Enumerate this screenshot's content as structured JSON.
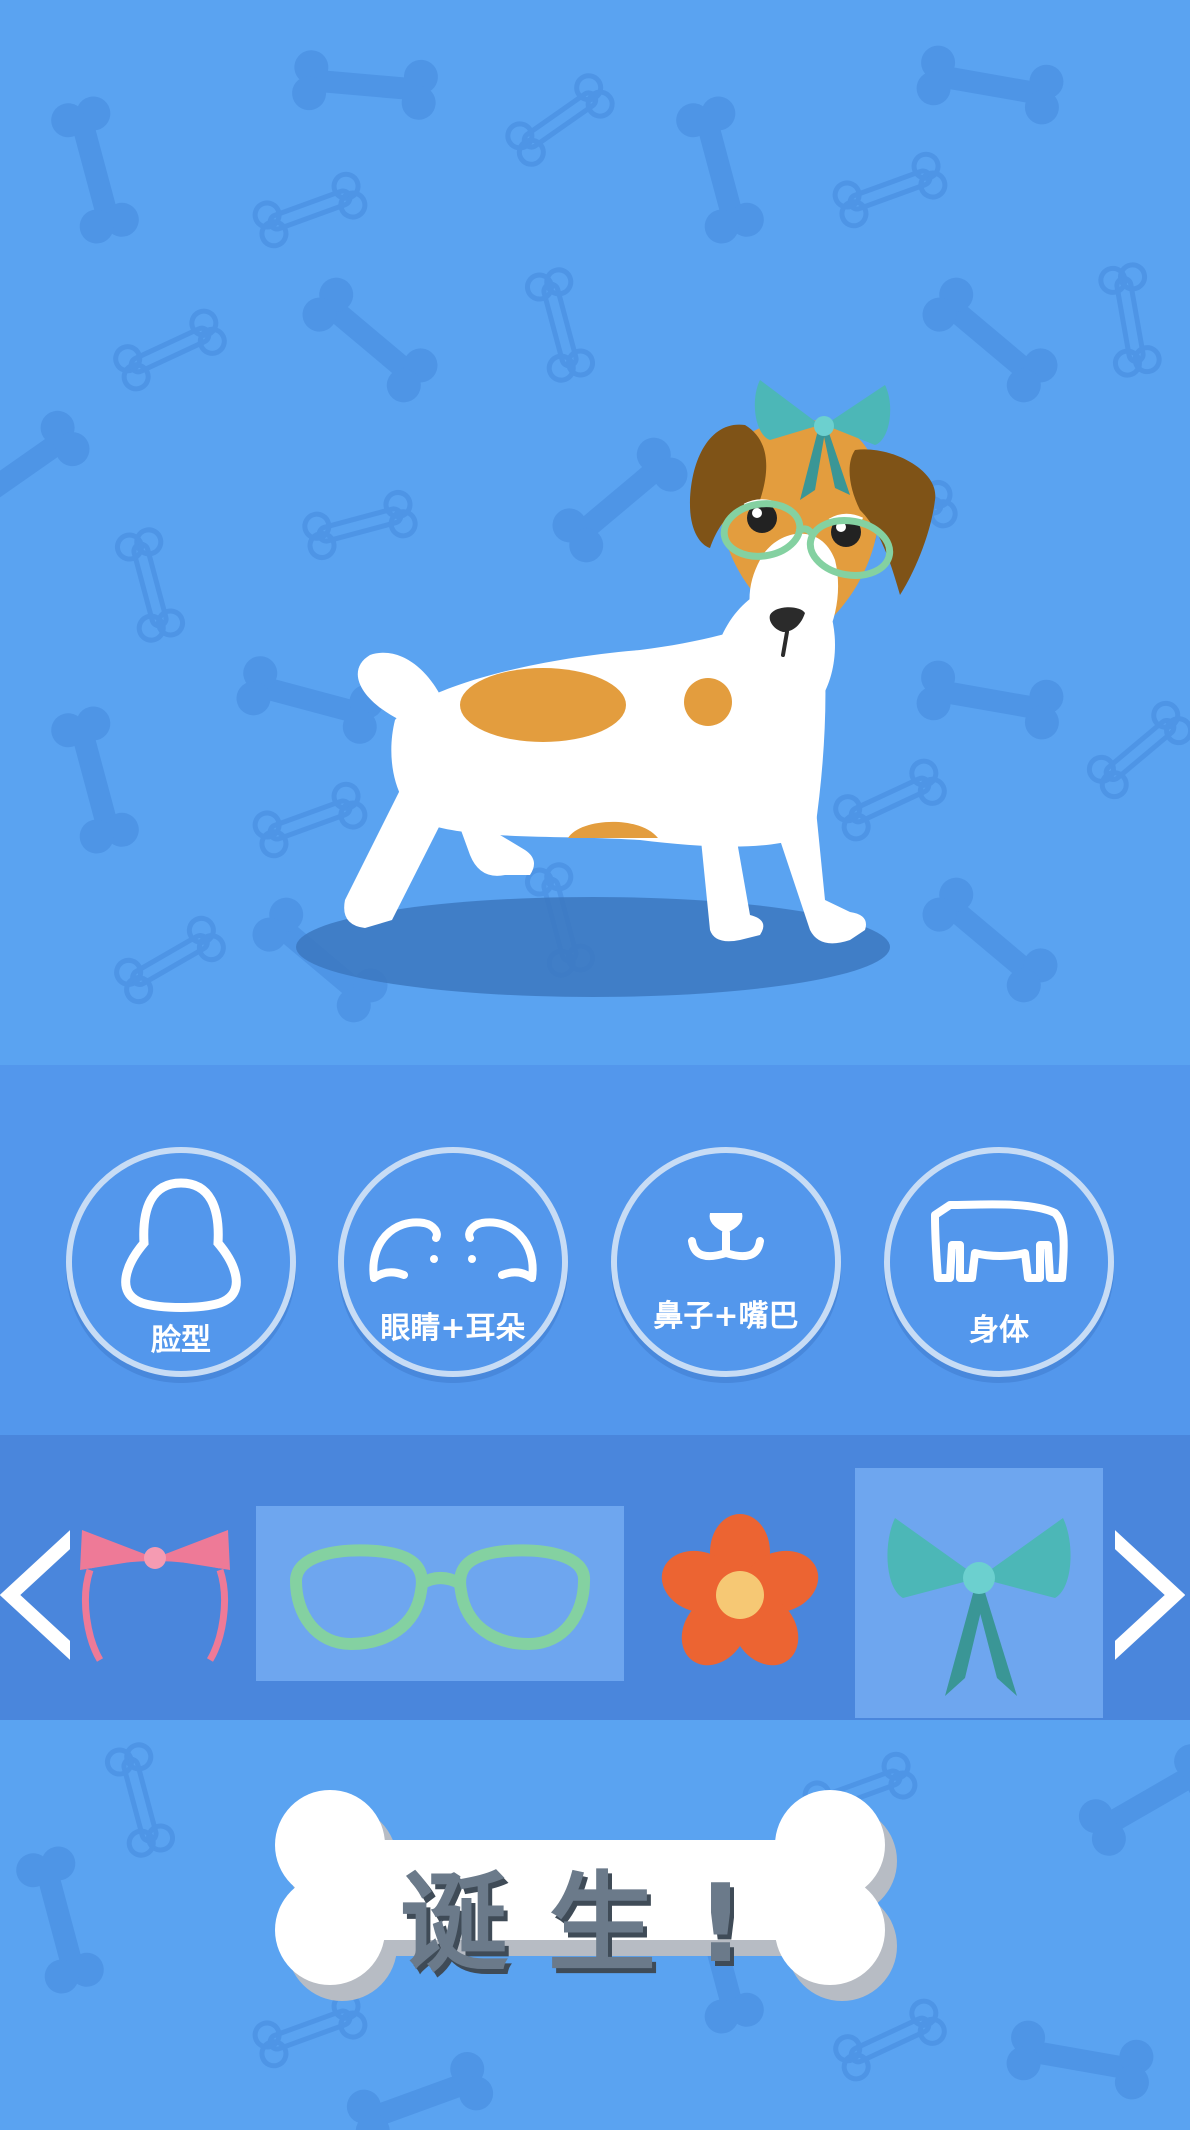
{
  "colors": {
    "background": "#5aa3f1",
    "bone_pattern": "#4e95e6",
    "category_band": "#5397ec",
    "items_bar": "#4a86dc",
    "selected_item": "#6ea6ef",
    "button_text": "#6b7a8a"
  },
  "categories": [
    {
      "label": "脸型",
      "icon": "face-shape-icon"
    },
    {
      "label": "眼睛+耳朵",
      "icon": "eyes-ears-icon"
    },
    {
      "label": "鼻子+嘴巴",
      "icon": "nose-mouth-icon"
    },
    {
      "label": "身体",
      "icon": "body-icon"
    }
  ],
  "accessories": [
    {
      "icon": "pink-headband-icon",
      "selected": false
    },
    {
      "icon": "green-glasses-icon",
      "selected": true
    },
    {
      "icon": "orange-flower-icon",
      "selected": false
    },
    {
      "icon": "teal-bow-icon",
      "selected": true
    }
  ],
  "navigation": {
    "prev_icon": "chevron-left-icon",
    "next_icon": "chevron-right-icon"
  },
  "action": {
    "birth_label": "诞生!"
  }
}
